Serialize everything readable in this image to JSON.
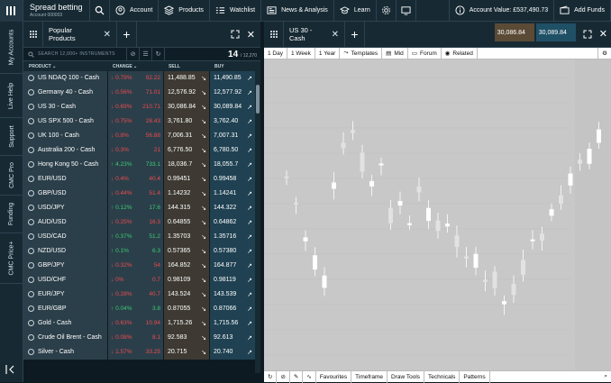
{
  "header": {
    "account_title": "Spread betting",
    "account_sub": "Account 000003",
    "search_label": "",
    "nav": [
      "Account",
      "Products",
      "Watchlist",
      "News & Analysis",
      "Learn"
    ],
    "account_value": "Account Value: £537,490.73",
    "add_funds": "Add Funds"
  },
  "sidebar": {
    "items": [
      "My Accounts",
      "Live Help",
      "Support",
      "CMC Pro",
      "Funding",
      "CMC Price+"
    ]
  },
  "watchlist": {
    "tab_label": "Popular Products",
    "search_placeholder": "SEARCH 12,000+ INSTRUMENTS",
    "count": "14",
    "count_total": "/ 12,270",
    "columns": [
      "PRODUCT",
      "CHANGE",
      "SELL",
      "BUY"
    ],
    "rows": [
      {
        "name": "US NDAQ 100 - Cash",
        "pct": "0.79%",
        "chg": "92.22",
        "dir": "down",
        "sell": "11,488.85",
        "buy": "11,490.85"
      },
      {
        "name": "Germany 40 - Cash",
        "pct": "0.56%",
        "chg": "71.01",
        "dir": "down",
        "sell": "12,576.92",
        "buy": "12,577.92"
      },
      {
        "name": "US 30 - Cash",
        "pct": "0.69%",
        "chg": "210.71",
        "dir": "down",
        "sell": "30,086.84",
        "buy": "30,089.84"
      },
      {
        "name": "US SPX 500 - Cash",
        "pct": "0.75%",
        "chg": "28.43",
        "dir": "down",
        "sell": "3,761.80",
        "buy": "3,762.40"
      },
      {
        "name": "UK 100 - Cash",
        "pct": "0.8%",
        "chg": "56.88",
        "dir": "down",
        "sell": "7,006.31",
        "buy": "7,007.31"
      },
      {
        "name": "Australia 200 - Cash",
        "pct": "0.3%",
        "chg": "21",
        "dir": "down",
        "sell": "6,776.50",
        "buy": "6,780.50"
      },
      {
        "name": "Hong Kong 50 - Cash",
        "pct": "4.23%",
        "chg": "733.1",
        "dir": "up",
        "sell": "18,036.7",
        "buy": "18,055.7"
      },
      {
        "name": "EUR/USD",
        "pct": "0.4%",
        "chg": "40.4",
        "dir": "down",
        "sell": "0.99451",
        "buy": "0.99458"
      },
      {
        "name": "GBP/USD",
        "pct": "0.44%",
        "chg": "51.4",
        "dir": "down",
        "sell": "1.14232",
        "buy": "1.14241"
      },
      {
        "name": "USD/JPY",
        "pct": "0.12%",
        "chg": "17.6",
        "dir": "up",
        "sell": "144.315",
        "buy": "144.322"
      },
      {
        "name": "AUD/USD",
        "pct": "0.25%",
        "chg": "16.3",
        "dir": "down",
        "sell": "0.64855",
        "buy": "0.64862"
      },
      {
        "name": "USD/CAD",
        "pct": "0.37%",
        "chg": "51.2",
        "dir": "up",
        "sell": "1.35703",
        "buy": "1.35716"
      },
      {
        "name": "NZD/USD",
        "pct": "0.1%",
        "chg": "6.3",
        "dir": "up",
        "sell": "0.57365",
        "buy": "0.57380"
      },
      {
        "name": "GBP/JPY",
        "pct": "0.32%",
        "chg": "54",
        "dir": "down",
        "sell": "164.852",
        "buy": "164.877"
      },
      {
        "name": "USD/CHF",
        "pct": "0%",
        "chg": "0.7",
        "dir": "down",
        "sell": "0.98109",
        "buy": "0.98119"
      },
      {
        "name": "EUR/JPY",
        "pct": "0.28%",
        "chg": "40.7",
        "dir": "down",
        "sell": "143.524",
        "buy": "143.539"
      },
      {
        "name": "EUR/GBP",
        "pct": "0.04%",
        "chg": "3.8",
        "dir": "up",
        "sell": "0.87055",
        "buy": "0.87066"
      },
      {
        "name": "Gold - Cash",
        "pct": "0.63%",
        "chg": "10.94",
        "dir": "down",
        "sell": "1,715.26",
        "buy": "1,715.56"
      },
      {
        "name": "Crude Oil Brent - Cash",
        "pct": "0.08%",
        "chg": "8.1",
        "dir": "down",
        "sell": "92.583",
        "buy": "92.613"
      },
      {
        "name": "Silver - Cash",
        "pct": "1.57%",
        "chg": "33.25",
        "dir": "down",
        "sell": "20.715",
        "buy": "20.740"
      }
    ]
  },
  "chart": {
    "tab_label": "US 30 - Cash",
    "sell_price": "30,086.84",
    "buy_price": "30,089.84",
    "toolbar": [
      "1 Day",
      "1 Week",
      "1 Year",
      "Templates",
      "Mid",
      "Forum",
      "Related"
    ],
    "bottom_toolbar": [
      "Favourites",
      "Timeframe",
      "Draw Tools",
      "Technicals",
      "Patterns"
    ]
  },
  "colors": {
    "up": "#3ccb72",
    "down": "#ef4a4f",
    "sell": "#3e3a33",
    "buy": "#1f4152",
    "bg": "#0e1a21"
  }
}
